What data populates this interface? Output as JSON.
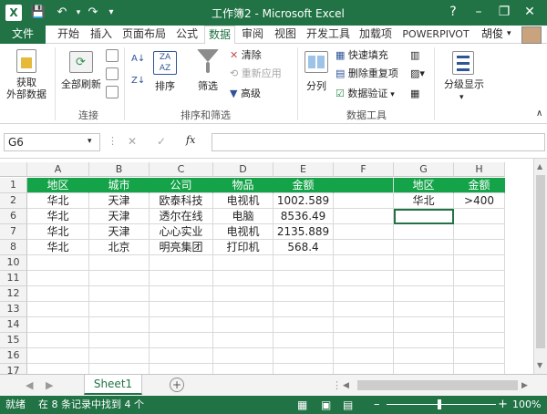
{
  "titlebar": {
    "logo": "X",
    "title": "工作簿2 - Microsoft Excel",
    "help": "?",
    "minimize": "–",
    "restore": "❐",
    "close": "✕"
  },
  "tabs": {
    "file": "文件",
    "items": [
      "开始",
      "插入",
      "页面布局",
      "公式",
      "数据",
      "审阅",
      "视图",
      "开发工具",
      "加载项",
      "POWERPIVOT"
    ],
    "active_index": 4,
    "user": "胡俊"
  },
  "ribbon": {
    "get_external": [
      "获取",
      "外部数据"
    ],
    "refresh_all": "全部刷新",
    "group_connections": "连接",
    "sort": "排序",
    "filter": "筛选",
    "clear": "清除",
    "reapply": "重新应用",
    "advanced": "高级",
    "group_sort_filter": "排序和筛选",
    "split": "分列",
    "flash_fill": "快速填充",
    "remove_dupes": "删除重复项",
    "data_validation": "数据验证",
    "group_data_tools": "数据工具",
    "outline": "分级显示"
  },
  "formula_bar": {
    "name_box": "G6",
    "cancel": "✕",
    "enter": "✓",
    "fx": "fx",
    "content": ""
  },
  "sheet": {
    "columns": [
      "A",
      "B",
      "C",
      "D",
      "E",
      "F",
      "G",
      "H"
    ],
    "rows": [
      {
        "num": "1",
        "cells": [
          "地区",
          "城市",
          "公司",
          "物品",
          "金额",
          "",
          "地区",
          "金额"
        ]
      },
      {
        "num": "2",
        "cells": [
          "华北",
          "天津",
          "欧泰科技",
          "电视机",
          "1002.589",
          "",
          "华北",
          ">400"
        ]
      },
      {
        "num": "6",
        "cells": [
          "华北",
          "天津",
          "透尔在线",
          "电脑",
          "8536.49",
          "",
          "",
          ""
        ]
      },
      {
        "num": "7",
        "cells": [
          "华北",
          "天津",
          "心心实业",
          "电视机",
          "2135.889",
          "",
          "",
          ""
        ]
      },
      {
        "num": "8",
        "cells": [
          "华北",
          "北京",
          "明亮集团",
          "打印机",
          "568.4",
          "",
          "",
          ""
        ]
      },
      {
        "num": "10",
        "cells": [
          "",
          "",
          "",
          "",
          "",
          "",
          "",
          ""
        ]
      },
      {
        "num": "11",
        "cells": [
          "",
          "",
          "",
          "",
          "",
          "",
          "",
          ""
        ]
      },
      {
        "num": "12",
        "cells": [
          "",
          "",
          "",
          "",
          "",
          "",
          "",
          ""
        ]
      },
      {
        "num": "13",
        "cells": [
          "",
          "",
          "",
          "",
          "",
          "",
          "",
          ""
        ]
      },
      {
        "num": "14",
        "cells": [
          "",
          "",
          "",
          "",
          "",
          "",
          "",
          ""
        ]
      },
      {
        "num": "15",
        "cells": [
          "",
          "",
          "",
          "",
          "",
          "",
          "",
          ""
        ]
      },
      {
        "num": "16",
        "cells": [
          "",
          "",
          "",
          "",
          "",
          "",
          "",
          ""
        ]
      },
      {
        "num": "17",
        "cells": [
          "",
          "",
          "",
          "",
          "",
          "",
          "",
          ""
        ]
      }
    ],
    "selected_cell": "G6"
  },
  "sheet_tabs": {
    "active": "Sheet1",
    "add": "+"
  },
  "status": {
    "ready": "就绪",
    "message": "在 8 条记录中找到 4 个",
    "zoom": "100%",
    "zoom_out": "–",
    "zoom_in": "+"
  },
  "colors": {
    "excel_green": "#217346",
    "header_fill": "#15a34a"
  }
}
